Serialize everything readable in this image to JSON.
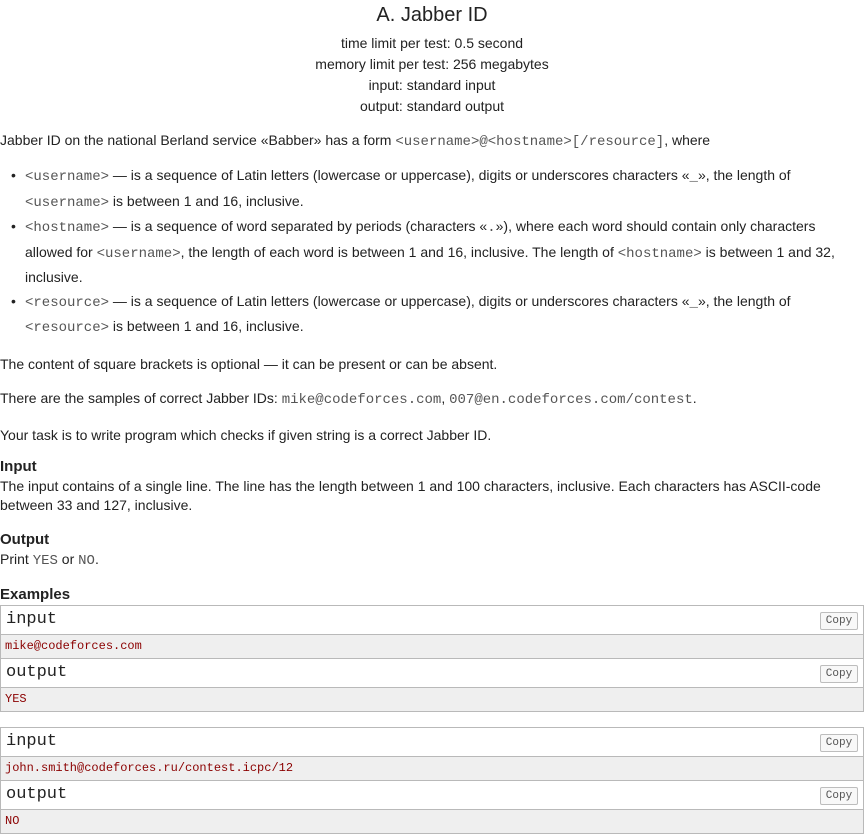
{
  "header": {
    "title": "A. Jabber ID",
    "time_limit": "time limit per test: 0.5 second",
    "memory_limit": "memory limit per test: 256 megabytes",
    "input": "input: standard input",
    "output": "output: standard output"
  },
  "statement": {
    "intro_prefix": "Jabber ID on the national Berland service «Babber» has a form ",
    "intro_form": "<username>@<hostname>[/resource]",
    "intro_suffix": ", where",
    "bullets": [
      {
        "a": "<username>",
        "b": " — is a sequence of Latin letters (lowercase or uppercase), digits or underscores characters «",
        "c": "_",
        "d": "», the length of ",
        "e": "<username>",
        "f": " is between 1 and 16, inclusive."
      },
      {
        "a": "<hostname>",
        "b": " — is a sequence of word separated by periods (characters «",
        "c": ".",
        "d": "»), where each word should contain only characters allowed for ",
        "e": "<username>",
        "f": ", the length of each word is between 1 and 16, inclusive. The length of ",
        "g": "<hostname>",
        "h": " is between 1 and 32, inclusive."
      },
      {
        "a": "<resource>",
        "b": " — is a sequence of Latin letters (lowercase or uppercase), digits or underscores characters «",
        "c": "_",
        "d": "», the length of ",
        "e": "<resource>",
        "f": " is between 1 and 16, inclusive."
      }
    ],
    "optional_text": "The content of square brackets is optional — it can be present or can be absent.",
    "samples_prefix": "There are the samples of correct Jabber IDs: ",
    "sample_id_1": "mike@codeforces.com",
    "samples_sep": ", ",
    "sample_id_2": "007@en.codeforces.com/contest",
    "samples_suffix": ".",
    "task_text": "Your task is to write program which checks if given string is a correct Jabber ID."
  },
  "input_section": {
    "title": "Input",
    "text": "The input contains of a single line. The line has the length between 1 and 100 characters, inclusive. Each characters has ASCII-code between 33 and 127, inclusive."
  },
  "output_section": {
    "title": "Output",
    "prefix": "Print ",
    "yes": "YES",
    "or": " or ",
    "no": "NO",
    "suffix": "."
  },
  "examples": {
    "title": "Examples",
    "copy_label": "Copy",
    "input_label": "input",
    "output_label": "output",
    "tests": [
      {
        "input": "mike@codeforces.com",
        "output": "YES"
      },
      {
        "input": "john.smith@codeforces.ru/contest.icpc/12",
        "output": "NO"
      }
    ]
  }
}
